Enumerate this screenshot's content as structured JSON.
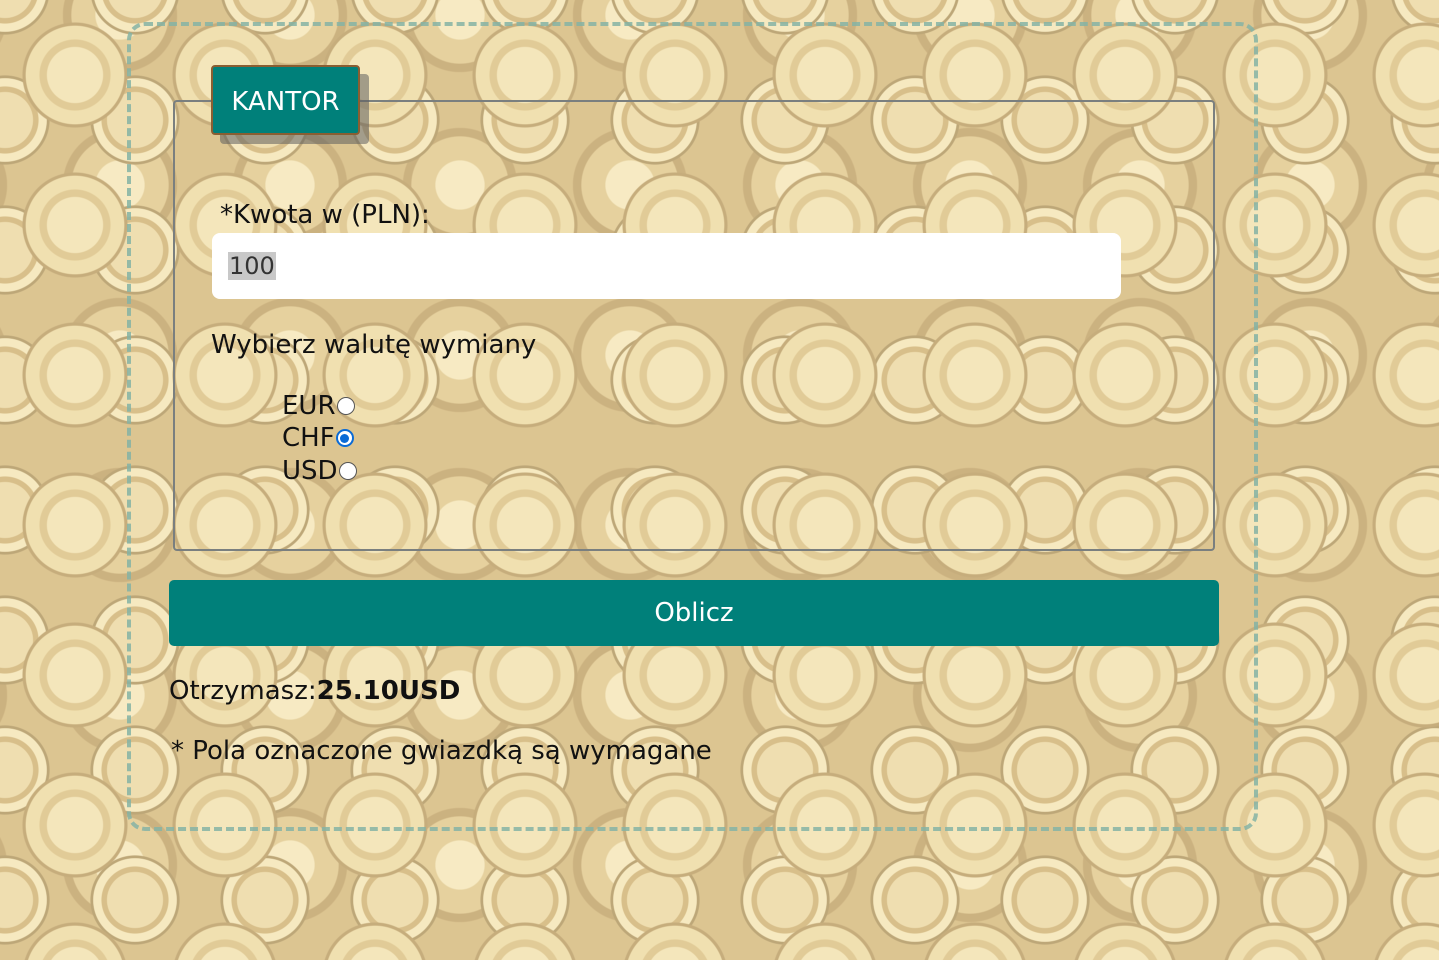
{
  "form": {
    "legend": "KANTOR",
    "amount_label": "*Kwota w (PLN):",
    "amount_value": "100",
    "currency_heading": "Wybierz walutę wymiany",
    "currencies": [
      {
        "label": "EUR",
        "checked": false
      },
      {
        "label": "CHF",
        "checked": true
      },
      {
        "label": "USD",
        "checked": false
      }
    ],
    "submit_label": "Oblicz"
  },
  "result": {
    "prefix": "Otrzymasz:",
    "value": "25.10USD"
  },
  "footnote": "* Pola oznaczone gwiazdką są wymagane",
  "colors": {
    "accent": "#00807a",
    "radio_checked": "#0a6bd6"
  }
}
